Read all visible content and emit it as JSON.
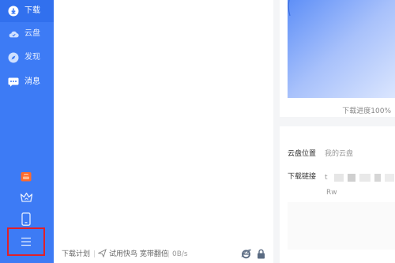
{
  "sidebar": {
    "items": [
      {
        "label": "下载",
        "icon": "download-icon",
        "active": true
      },
      {
        "label": "云盘",
        "icon": "cloud-icon",
        "active": false
      },
      {
        "label": "发现",
        "icon": "compass-icon",
        "active": false
      },
      {
        "label": "消息",
        "icon": "chat-icon",
        "active": false
      }
    ],
    "bottom_icons": [
      "gift-icon",
      "crown-icon",
      "phone-icon",
      "menu-icon"
    ],
    "highlighted": "menu-icon"
  },
  "statusbar": {
    "plan": "下载计划",
    "trial": "试用快鸟 宽带翻倍",
    "speed": "0B/s"
  },
  "detail": {
    "progress_text": "下载进度100%",
    "progress_value": 1.0
  },
  "info": {
    "location_label": "云盘位置",
    "location_value": "我的云盘",
    "link_label": "下载链接",
    "link_prefix": "t",
    "link_suffix": "Rw"
  },
  "colors": {
    "sidebar": "#3d7bf5",
    "accent": "#4a80f5",
    "highlight": "#e0202a"
  }
}
